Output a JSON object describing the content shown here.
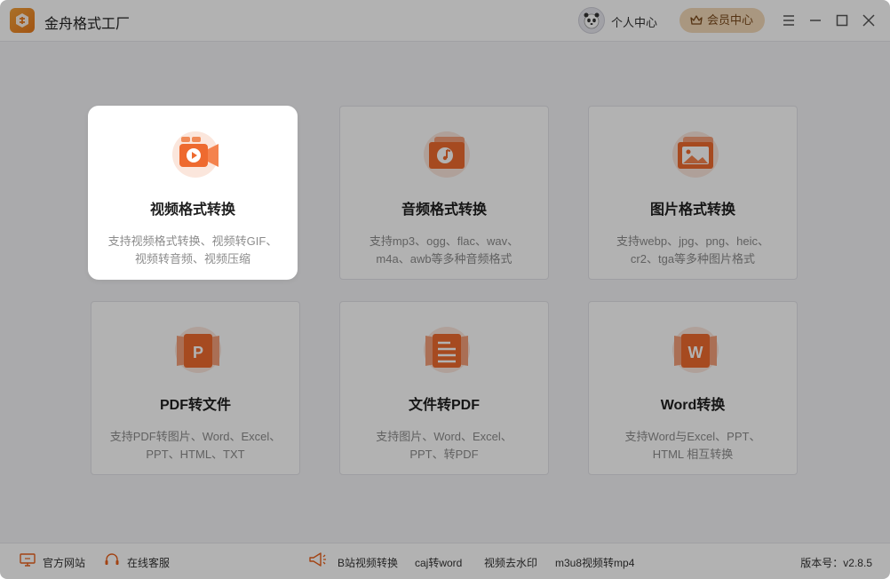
{
  "app": {
    "title": "金舟格式工厂"
  },
  "header": {
    "personal_center": "个人中心",
    "vip_center": "会员中心"
  },
  "cards": [
    {
      "title": "视频格式转换",
      "desc_line1": "支持视频格式转换、视频转GIF、",
      "desc_line2": "视频转音频、视频压缩",
      "icon": "video-icon"
    },
    {
      "title": "音频格式转换",
      "desc_line1": "支持mp3、ogg、flac、wav、",
      "desc_line2": "m4a、awb等多种音频格式",
      "icon": "music-icon"
    },
    {
      "title": "图片格式转换",
      "desc_line1": "支持webp、jpg、png、heic、",
      "desc_line2": "cr2、tga等多种图片格式",
      "icon": "image-icon"
    },
    {
      "title": "PDF转文件",
      "desc_line1": "支持PDF转图片、Word、Excel、",
      "desc_line2": "PPT、HTML、TXT",
      "icon": "pdf-p-icon"
    },
    {
      "title": "文件转PDF",
      "desc_line1": "支持图片、Word、Excel、",
      "desc_line2": "PPT、转PDF",
      "icon": "document-icon"
    },
    {
      "title": "Word转换",
      "desc_line1": "支持Word与Excel、PPT、",
      "desc_line2": "HTML 相互转换",
      "icon": "word-w-icon"
    }
  ],
  "footer": {
    "official_site": "官方网站",
    "online_service": "在线客服",
    "links": [
      "B站视频转换",
      "caj转word",
      "视频去水印",
      "m3u8视频转mp4"
    ],
    "version": "版本号：v2.8.5"
  },
  "colors": {
    "accent": "#e8601c",
    "vip_bg": "#f3d9b8"
  }
}
